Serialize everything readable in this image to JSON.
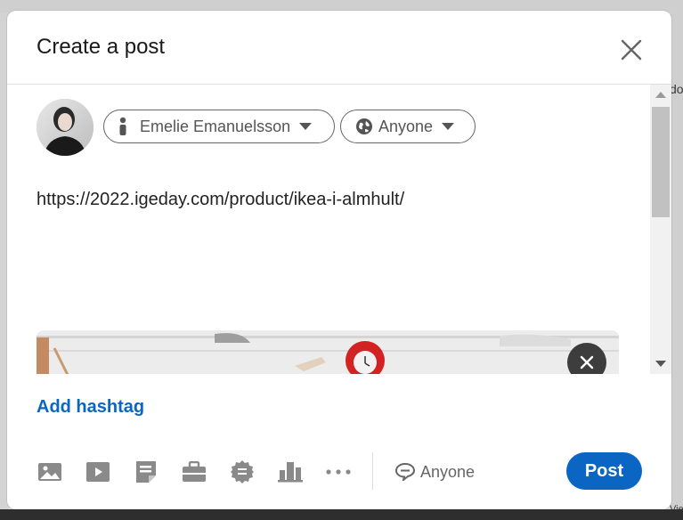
{
  "modal": {
    "title": "Create a post"
  },
  "author": {
    "name": "Emelie Emanuelsson"
  },
  "visibility": {
    "label": "Anyone"
  },
  "post": {
    "text": "https://2022.igeday.com/product/ikea-i-almhult/"
  },
  "hashtag": {
    "label": "Add hashtag"
  },
  "footer": {
    "comment_control_label": "Anyone",
    "post_label": "Post",
    "icons": [
      "photo-icon",
      "video-icon",
      "document-icon",
      "job-icon",
      "celebrate-icon",
      "poll-icon",
      "more-icon"
    ]
  },
  "background": {
    "right_snippet_top": "do",
    "right_snippet_bottom": "Vie"
  },
  "colors": {
    "accent": "#0a66c2",
    "text_primary": "#191919",
    "text_secondary": "#666666",
    "remove_button": "#3d3d3d"
  }
}
